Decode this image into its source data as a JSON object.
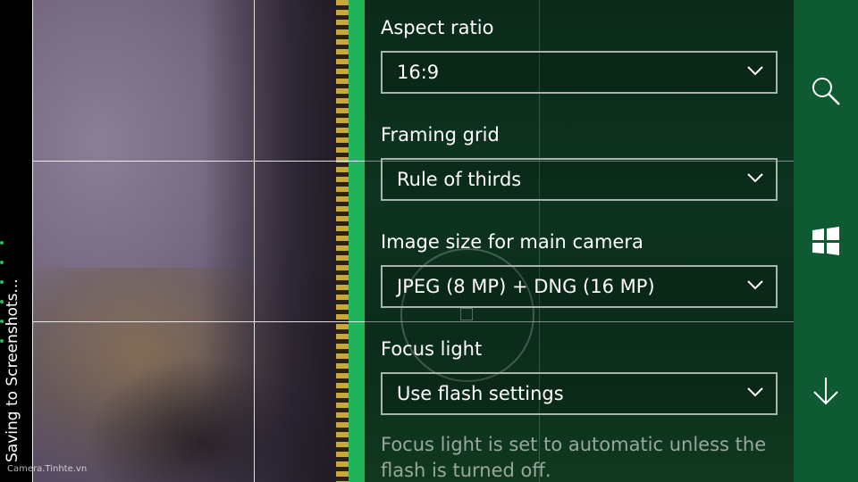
{
  "status": {
    "message": "Saving to Screenshots..."
  },
  "watermark": "Camera.Tinhte.vn",
  "settings": {
    "items": [
      {
        "label": "Aspect ratio",
        "value": "16:9"
      },
      {
        "label": "Framing grid",
        "value": "Rule of thirds"
      },
      {
        "label": "Image size for main camera",
        "value": "JPEG (8 MP) + DNG (16 MP)"
      },
      {
        "label": "Focus light",
        "value": "Use flash settings"
      }
    ],
    "description": "Focus light is set to automatic unless the flash is turned off."
  },
  "appbar": {
    "buttons": [
      {
        "icon": "search-icon"
      },
      {
        "icon": "windows-icon"
      },
      {
        "icon": "arrow-down-icon"
      }
    ]
  },
  "colors": {
    "accent": "#1fb35a",
    "panel": "#0d3420",
    "appbar": "#0e5a33",
    "dropdown_border": "#a7b5ac"
  }
}
